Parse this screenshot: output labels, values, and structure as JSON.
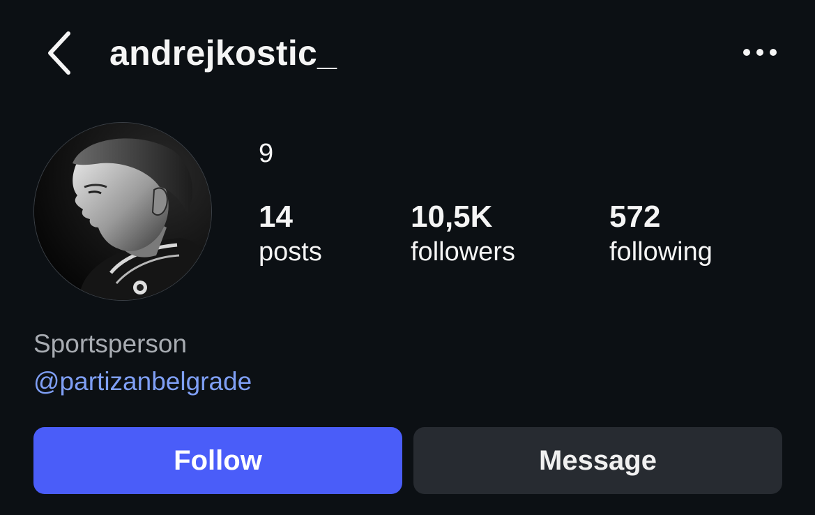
{
  "header": {
    "username": "andrejkostic_",
    "back_icon": "chevron-left-icon",
    "more_icon": "more-horizontal-icon"
  },
  "profile": {
    "highlight_count": "9",
    "stats": {
      "posts": {
        "value": "14",
        "label": "posts"
      },
      "followers": {
        "value": "10,5K",
        "label": "followers"
      },
      "following": {
        "value": "572",
        "label": "following"
      }
    },
    "category": "Sportsperson",
    "link": "@partizanbelgrade"
  },
  "actions": {
    "follow_label": "Follow",
    "message_label": "Message"
  },
  "colors": {
    "background": "#0c1014",
    "follow_button": "#4a5df9",
    "message_button": "#272b31",
    "link": "#7f9ff5",
    "category_text": "#a8acb2"
  }
}
